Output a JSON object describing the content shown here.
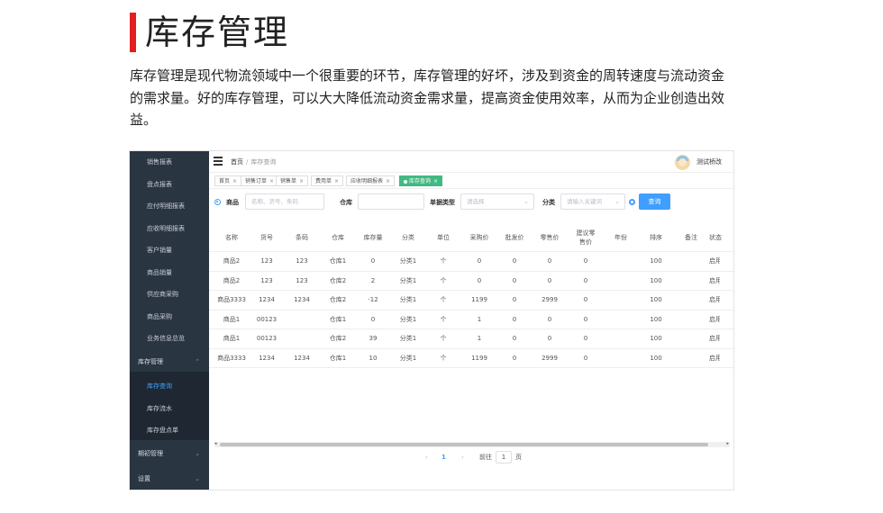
{
  "page": {
    "title": "库存管理",
    "intro": "库存管理是现代物流领域中一个很重要的环节，库存管理的好坏，涉及到资金的周转速度与流动资金的需求量。好的库存管理，可以大大降低流动资金需求量，提高资金使用效率，从而为企业创造出效益。"
  },
  "colors": {
    "accent_red": "#e41e1e",
    "sidebar_bg": "#2a3542",
    "primary": "#409eff",
    "tab_active": "#42b983"
  },
  "sidebar": {
    "items": [
      "销售报表",
      "盘点报表",
      "应付明细报表",
      "应收明细报表",
      "客户销量",
      "商品销量",
      "供应商采购",
      "商品采购",
      "业务信息总览"
    ],
    "group_inventory": "库存管理",
    "sub_items": [
      "库存查询",
      "库存流水",
      "库存盘点单"
    ],
    "group_period": "期初管理",
    "group_settings": "设置"
  },
  "topbar": {
    "breadcrumb_home": "首页",
    "breadcrumb_sep": "/",
    "breadcrumb_current": "库存查询",
    "username": "测试桥改"
  },
  "tabs": [
    "首页",
    "销售订单",
    "销售单",
    "费用单",
    "应收明细报表",
    "库存查询"
  ],
  "filters": {
    "goods_label": "商品",
    "goods_placeholder": "名称、货号、条码",
    "warehouse_label": "仓库",
    "doc_type_label": "单据类型",
    "doc_type_placeholder": "请选择",
    "category_label": "分类",
    "category_placeholder": "请输入关键词",
    "search_button": "查询"
  },
  "table": {
    "headers": [
      "名称",
      "货号",
      "条码",
      "仓库",
      "库存量",
      "分类",
      "单位",
      "采购价",
      "批发价",
      "零售价",
      "建议零售价",
      "年份",
      "排序",
      "备注",
      "状态"
    ],
    "rows": [
      [
        "商品2",
        "123",
        "123",
        "仓库1",
        "0",
        "分类1",
        "个",
        "0",
        "0",
        "0",
        "0",
        "",
        "100",
        "",
        "启用"
      ],
      [
        "商品2",
        "123",
        "123",
        "仓库2",
        "2",
        "分类1",
        "个",
        "0",
        "0",
        "0",
        "0",
        "",
        "100",
        "",
        "启用"
      ],
      [
        "商品3333",
        "1234",
        "1234",
        "仓库2",
        "-12",
        "分类1",
        "个",
        "1199",
        "0",
        "2999",
        "0",
        "",
        "100",
        "",
        "启用"
      ],
      [
        "商品1",
        "00123",
        "",
        "仓库1",
        "0",
        "分类1",
        "个",
        "1",
        "0",
        "0",
        "0",
        "",
        "100",
        "",
        "启用"
      ],
      [
        "商品1",
        "00123",
        "",
        "仓库2",
        "39",
        "分类1",
        "个",
        "1",
        "0",
        "0",
        "0",
        "",
        "100",
        "",
        "启用"
      ],
      [
        "商品3333",
        "1234",
        "1234",
        "仓库1",
        "10",
        "分类1",
        "个",
        "1199",
        "0",
        "2999",
        "0",
        "",
        "100",
        "",
        "启用"
      ]
    ]
  },
  "pagination": {
    "current": "1",
    "goto_label": "前往",
    "page_input": "1",
    "page_suffix": "页"
  }
}
